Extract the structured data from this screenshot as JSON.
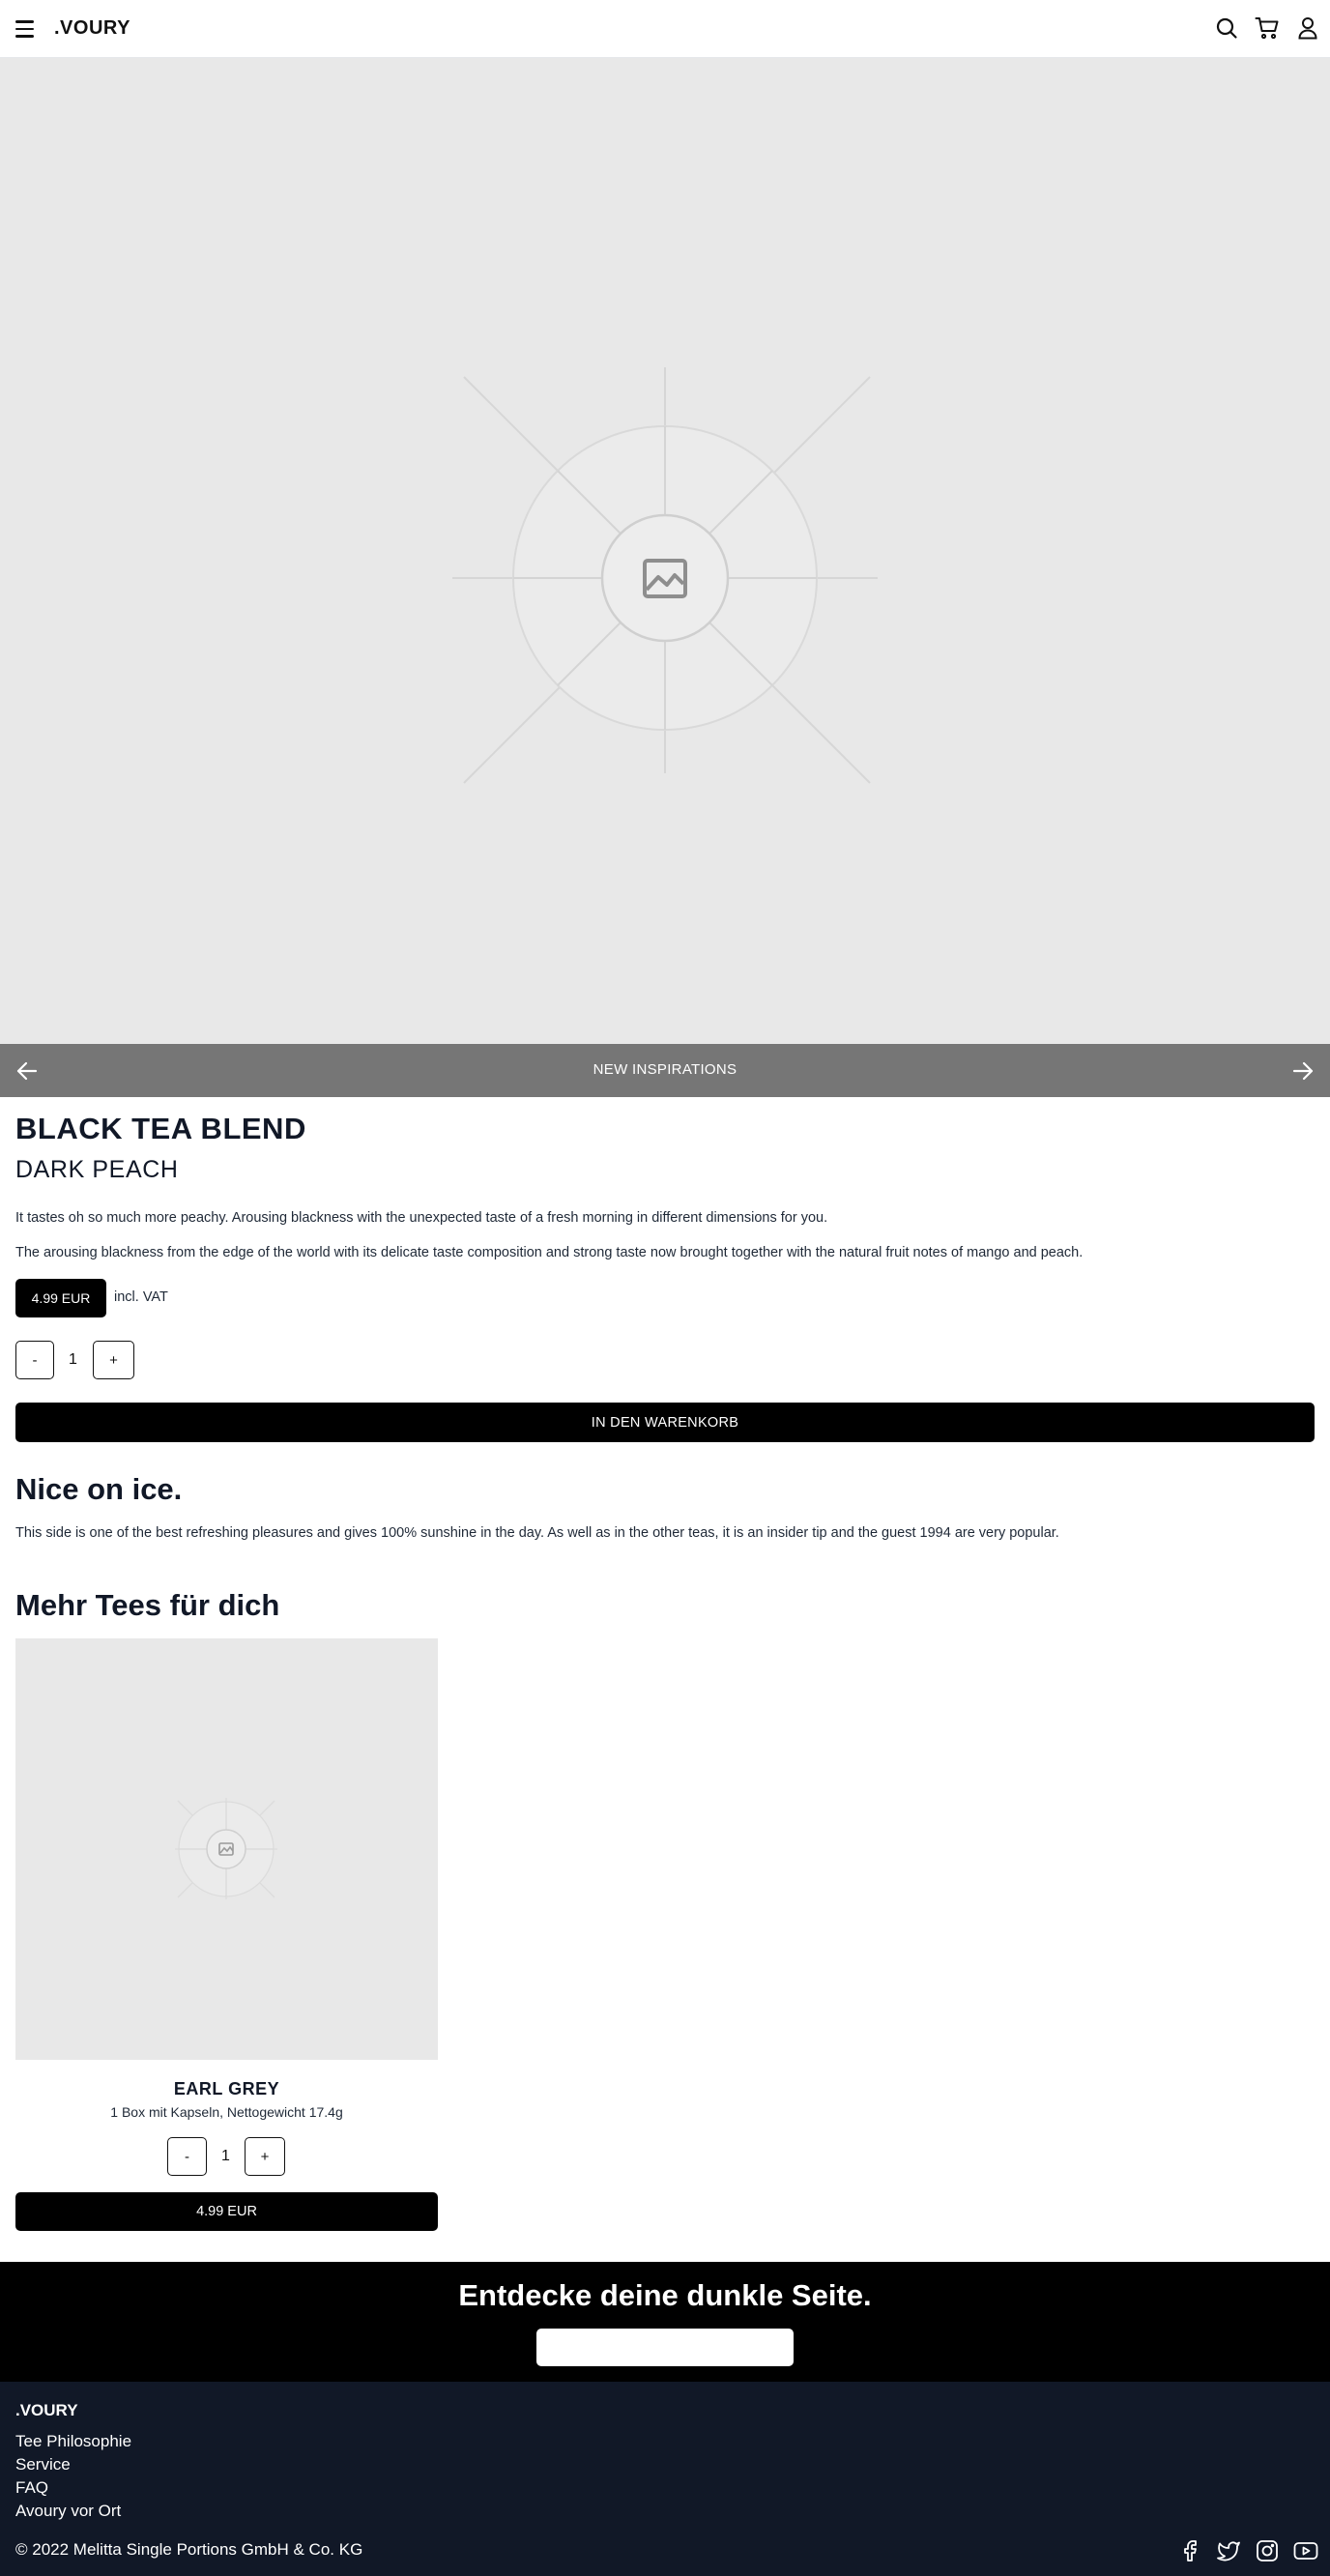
{
  "header": {
    "logo": ".VOURY",
    "icons": [
      "menu-icon",
      "search-icon",
      "cart-icon",
      "user-icon"
    ]
  },
  "hero": {
    "image": "image-placeholder-icon"
  },
  "slider": {
    "title": "NEW INSPIRATIONS",
    "prev_icon": "arrow-left-icon",
    "next_icon": "arrow-right-icon"
  },
  "product": {
    "title": "BLACK TEA BLEND",
    "subtitle": "DARK PEACH",
    "description_1": "It tastes oh so much more peachy. Arousing blackness with the unexpected taste of a fresh morning in different dimensions for you.",
    "description_2": "The arousing blackness from the edge of the world with its delicate taste composition and strong taste now brought together with the natural fruit notes of mango and peach.",
    "price": "4.99 EUR",
    "vat": "incl. VAT",
    "qty_minus": "-",
    "qty_value": "1",
    "qty_plus": "+",
    "add_to_cart": "IN DEN WARENKORB"
  },
  "ice": {
    "title": "Nice on ice.",
    "text": "This side is one of the best refreshing pleasures and gives 100% sunshine in the day. As well as in the other teas, it is an insider tip and the guest 1994 are very popular."
  },
  "more": {
    "title": "Mehr Tees für dich",
    "products": [
      {
        "name": "EARL GREY",
        "subtitle": "1 Box mit Kapseln, Nettogewicht 17.4g",
        "qty_minus": "-",
        "qty_value": "1",
        "qty_plus": "+",
        "price": "4.99 EUR"
      }
    ]
  },
  "banner": {
    "title": "Entdecke deine dunkle Seite.",
    "button_label": ""
  },
  "footer": {
    "logo": ".VOURY",
    "links": [
      "Tee Philosophie",
      "Service",
      "FAQ",
      "Avoury vor Ort"
    ],
    "copyright": "© 2022 Melitta Single Portions GmbH & Co. KG",
    "social": [
      "facebook-icon",
      "twitter-icon",
      "instagram-icon",
      "youtube-icon"
    ]
  },
  "colors": {
    "primary": "#000000",
    "footer_bg": "#111827",
    "slider_bg": "#767676",
    "placeholder_bg": "#e8e8e8"
  }
}
